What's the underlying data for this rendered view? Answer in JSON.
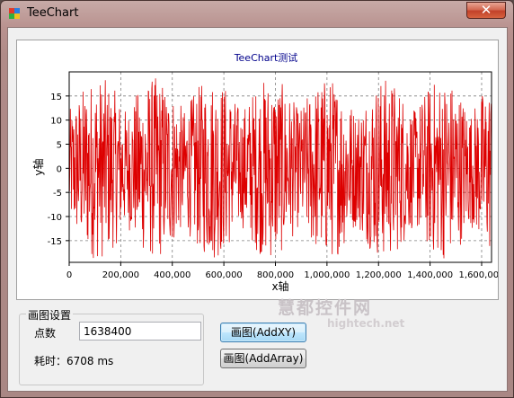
{
  "window": {
    "title": "TeeChart",
    "close_symbol": "✕"
  },
  "chart_data": {
    "type": "line",
    "title": "TeeChart测试",
    "xlabel": "x轴",
    "ylabel": "y轴",
    "xlim": [
      0,
      1638400
    ],
    "ylim": [
      -19.5,
      20
    ],
    "x_ticks": [
      "0",
      "200,000",
      "400,000",
      "600,000",
      "800,000",
      "1,000,000",
      "1,200,000",
      "1,400,000",
      "1,600,000"
    ],
    "x_tick_values": [
      0,
      200000,
      400000,
      600000,
      800000,
      1000000,
      1200000,
      1400000,
      1600000
    ],
    "y_ticks": [
      "15",
      "10",
      "5",
      "0",
      "-5",
      "-10",
      "-15"
    ],
    "y_tick_values": [
      15,
      10,
      5,
      0,
      -5,
      -10,
      -15
    ],
    "grid": true,
    "series": [
      {
        "color": "#dd0000",
        "point_count": 1638400
      }
    ]
  },
  "settings": {
    "group_label": "画图设置",
    "points_label": "点数",
    "points_value": "1638400",
    "time_label": "耗时：6708 ms"
  },
  "buttons": {
    "add_xy": "画图(AddXY)",
    "add_array": "画图(AddArray)"
  },
  "watermark": {
    "text": "慧都控件网",
    "sub": "hightech.net"
  }
}
